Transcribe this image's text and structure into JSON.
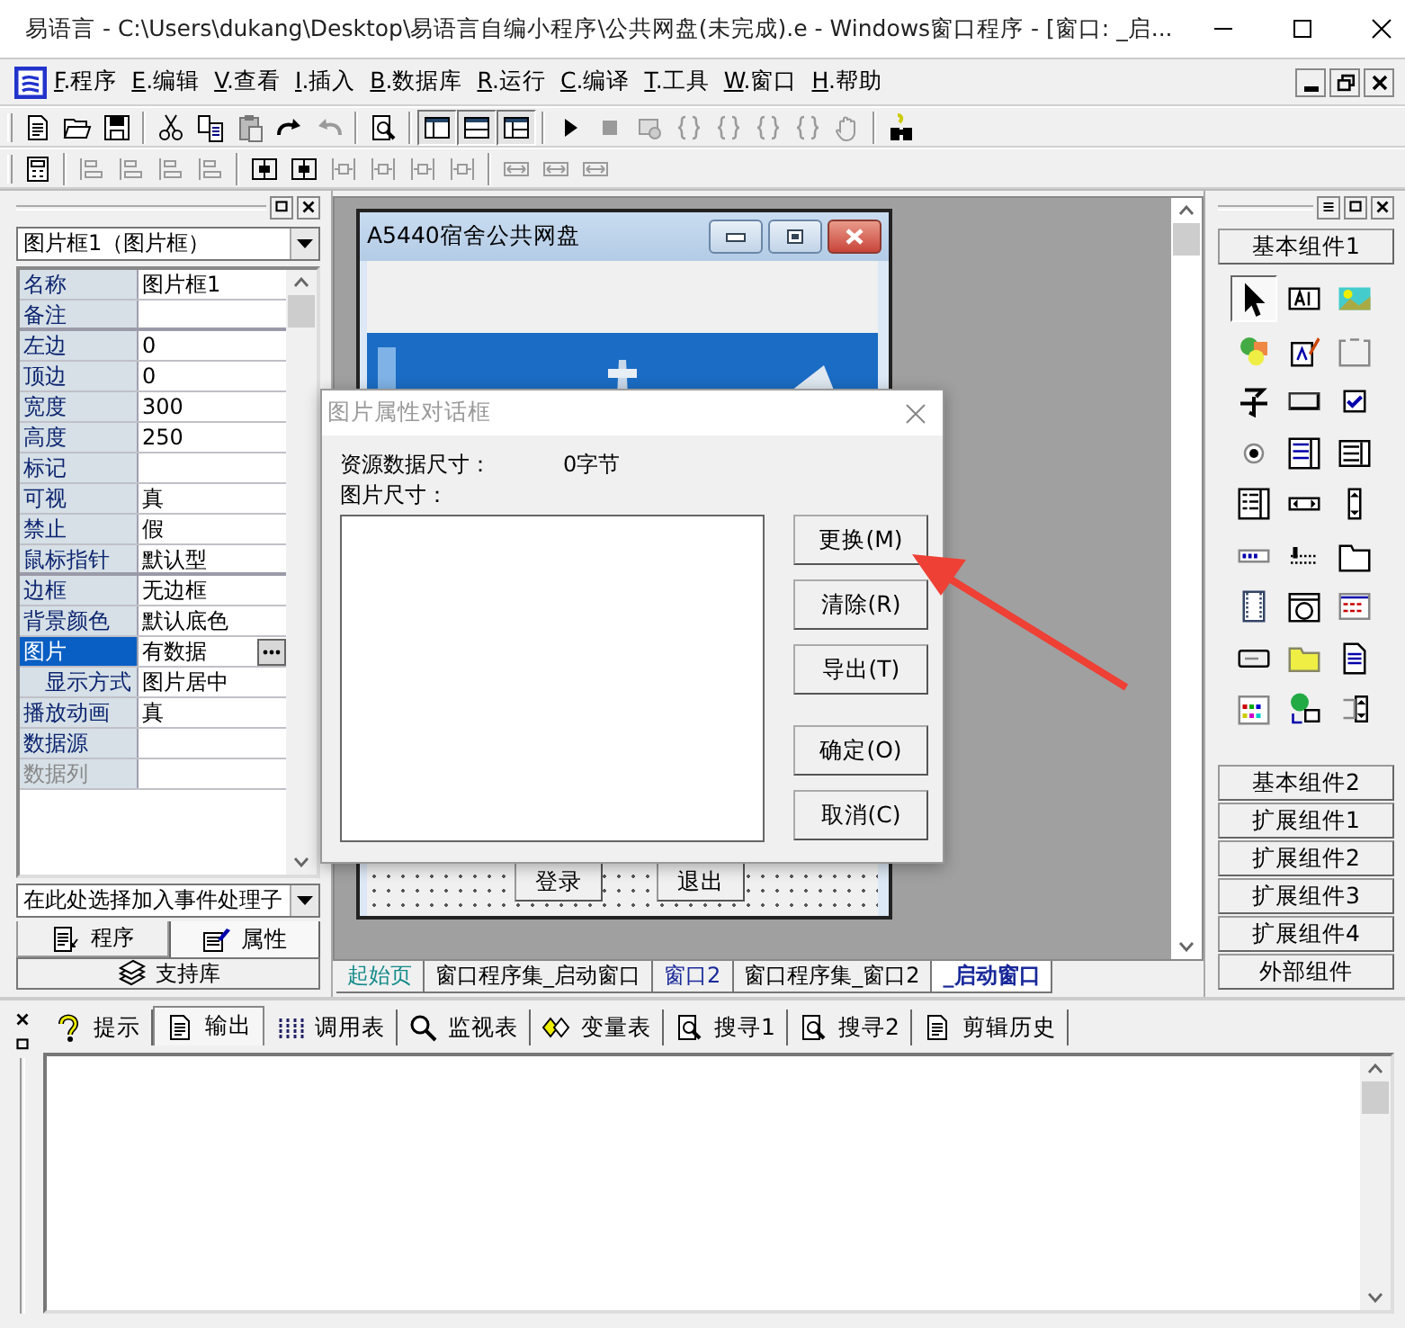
{
  "window": {
    "title": "易语言 - C:\\Users\\dukang\\Desktop\\易语言自编小程序\\公共网盘(未完成).e - Windows窗口程序 - [窗口: _启..."
  },
  "menu": [
    {
      "mnemonic": "F",
      "label": ".程序"
    },
    {
      "mnemonic": "E",
      "label": ".编辑"
    },
    {
      "mnemonic": "V",
      "label": ".查看"
    },
    {
      "mnemonic": "I",
      "label": ".插入"
    },
    {
      "mnemonic": "B",
      "label": ".数据库"
    },
    {
      "mnemonic": "R",
      "label": ".运行"
    },
    {
      "mnemonic": "C",
      "label": ".编译"
    },
    {
      "mnemonic": "T",
      "label": ".工具"
    },
    {
      "mnemonic": "W",
      "label": ".窗口"
    },
    {
      "mnemonic": "H",
      "label": ".帮助"
    }
  ],
  "properties": {
    "selector": "图片框1（图片框）",
    "rows": [
      {
        "name": "名称",
        "value": "图片框1",
        "selected": false,
        "disabled": false,
        "separator_after": false
      },
      {
        "name": "备注",
        "value": "",
        "selected": false,
        "disabled": false,
        "separator_after": true
      },
      {
        "name": "左边",
        "value": "0",
        "selected": false,
        "disabled": false,
        "separator_after": false
      },
      {
        "name": "顶边",
        "value": "0",
        "selected": false,
        "disabled": false,
        "separator_after": false
      },
      {
        "name": "宽度",
        "value": "300",
        "selected": false,
        "disabled": false,
        "separator_after": false
      },
      {
        "name": "高度",
        "value": "250",
        "selected": false,
        "disabled": false,
        "separator_after": false
      },
      {
        "name": "标记",
        "value": "",
        "selected": false,
        "disabled": false,
        "separator_after": false
      },
      {
        "name": "可视",
        "value": "真",
        "selected": false,
        "disabled": false,
        "separator_after": false
      },
      {
        "name": "禁止",
        "value": "假",
        "selected": false,
        "disabled": false,
        "separator_after": false
      },
      {
        "name": "鼠标指针",
        "value": "默认型",
        "selected": false,
        "disabled": false,
        "separator_after": true
      },
      {
        "name": "边框",
        "value": "无边框",
        "selected": false,
        "disabled": false,
        "separator_after": false
      },
      {
        "name": "背景颜色",
        "value": "默认底色",
        "selected": false,
        "disabled": false,
        "separator_after": false
      },
      {
        "name": "图片",
        "value": "有数据",
        "selected": true,
        "disabled": false,
        "separator_after": false,
        "children": [
          {
            "name": "显示方式",
            "value": "图片居中",
            "selected": false,
            "disabled": false,
            "separator_after": false
          }
        ]
      },
      {
        "name": "播放动画",
        "value": "真",
        "selected": false,
        "disabled": false,
        "separator_after": false
      },
      {
        "name": "数据源",
        "value": "",
        "selected": false,
        "disabled": false,
        "separator_after": false
      },
      {
        "name": "数据列",
        "value": "",
        "selected": false,
        "disabled": true,
        "separator_after": false
      }
    ],
    "event_selector": "在此处选择加入事件处理子"
  },
  "panel_tabs": [
    {
      "label": "程序",
      "selected": false
    },
    {
      "label": "属性",
      "selected": true
    }
  ],
  "support_tab": "支持库",
  "designer": {
    "title": "A5440宿舍公共网盘",
    "buttons": [
      "登录",
      "退出"
    ]
  },
  "doc_tabs": [
    {
      "label": "起始页",
      "kind": "start",
      "selected": false
    },
    {
      "label": "窗口程序集_启动窗口",
      "kind": "code",
      "selected": false
    },
    {
      "label": "窗口2",
      "kind": "window",
      "selected": false
    },
    {
      "label": "窗口程序集_窗口2",
      "kind": "code",
      "selected": false
    },
    {
      "label": "_启动窗口",
      "kind": "window",
      "selected": true
    }
  ],
  "toolbox": {
    "groups": [
      {
        "label": "基本组件1",
        "expanded": true
      },
      {
        "label": "基本组件2",
        "expanded": false
      },
      {
        "label": "扩展组件1",
        "expanded": false
      },
      {
        "label": "扩展组件2",
        "expanded": false
      },
      {
        "label": "扩展组件3",
        "expanded": false
      },
      {
        "label": "扩展组件4",
        "expanded": false
      },
      {
        "label": "外部组件",
        "expanded": false
      }
    ],
    "tools": [
      {
        "selected": true
      },
      {
        "selected": false
      },
      {
        "selected": false
      },
      {
        "selected": false
      },
      {
        "selected": false
      },
      {
        "selected": false
      },
      {
        "selected": false
      },
      {
        "selected": false
      },
      {
        "selected": false
      },
      {
        "selected": false
      },
      {
        "selected": false
      },
      {
        "selected": false
      },
      {
        "selected": false
      },
      {
        "selected": false
      },
      {
        "selected": false
      },
      {
        "selected": false
      },
      {
        "selected": false
      },
      {
        "selected": false
      },
      {
        "selected": false
      },
      {
        "selected": false
      },
      {
        "selected": false
      },
      {
        "selected": false
      },
      {
        "selected": false
      },
      {
        "selected": false
      },
      {
        "selected": false
      },
      {
        "selected": false
      },
      {
        "selected": false
      }
    ]
  },
  "dialog": {
    "title": "图片属性对话框",
    "data_size_label": "资源数据尺寸：",
    "data_size_value": "0字节",
    "image_size_label": "图片尺寸：",
    "button_groups": [
      [
        "更换(M)",
        "清除(R)",
        "导出(T)"
      ],
      [
        "确定(O)",
        "取消(C)"
      ]
    ]
  },
  "output_tabs": [
    {
      "label": "提示",
      "selected": false
    },
    {
      "label": "输出",
      "selected": true
    },
    {
      "label": "调用表",
      "selected": false
    },
    {
      "label": "监视表",
      "selected": false
    },
    {
      "label": "变量表",
      "selected": false
    },
    {
      "label": "搜寻1",
      "selected": false
    },
    {
      "label": "搜寻2",
      "selected": false
    },
    {
      "label": "剪辑历史",
      "selected": false
    }
  ]
}
